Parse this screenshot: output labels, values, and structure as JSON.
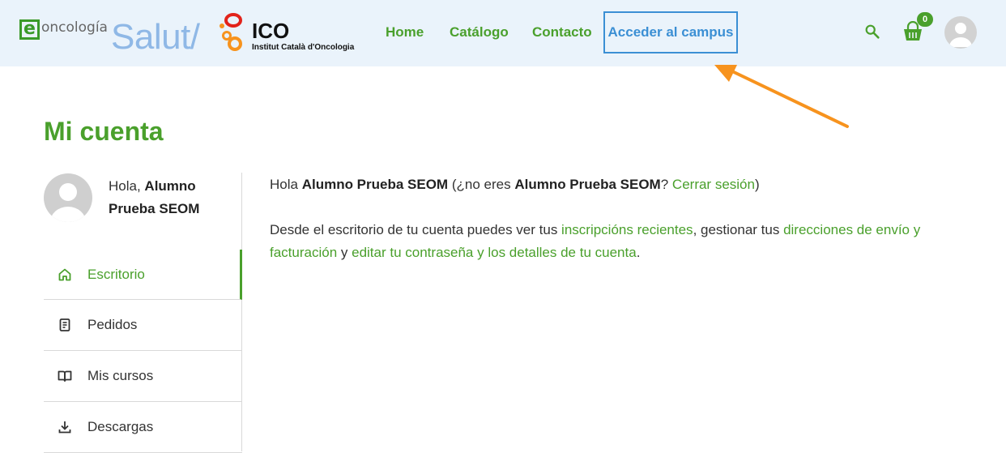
{
  "header": {
    "logo_e_word": "oncología",
    "logo_salut": "Salut/",
    "logo_ico": "ICO",
    "logo_ico_sub": "Institut Català d'Oncologia",
    "nav": [
      {
        "label": "Home"
      },
      {
        "label": "Catálogo"
      },
      {
        "label": "Contacto"
      }
    ],
    "campus_label": "Acceder al campus",
    "cart_count": "0",
    "icons": {
      "search": "search-icon",
      "cart": "shopping-bag-icon",
      "avatar": "user-avatar-icon"
    },
    "colors": {
      "accent_green": "#4aa02c",
      "campus_blue": "#3b8fd4",
      "header_bg": "#eaf3fb",
      "arrow": "#f7931e"
    }
  },
  "page": {
    "title": "Mi cuenta"
  },
  "sidebar": {
    "greeting_prefix": "Hola, ",
    "user_name": "Alumno Prueba SEOM",
    "items": [
      {
        "label": "Escritorio",
        "icon": "home-icon",
        "active": true
      },
      {
        "label": "Pedidos",
        "icon": "receipt-icon",
        "active": false
      },
      {
        "label": "Mis cursos",
        "icon": "book-icon",
        "active": false
      },
      {
        "label": "Descargas",
        "icon": "download-icon",
        "active": false
      }
    ]
  },
  "main": {
    "line1": {
      "hola": "Hola ",
      "name": "Alumno Prueba SEOM",
      "mid": " (¿no eres ",
      "name2": "Alumno Prueba SEOM",
      "q": "? ",
      "logout": "Cerrar sesión",
      "close": ")"
    },
    "line2": {
      "t1": "Desde el escritorio de tu cuenta puedes ver tus ",
      "l1": "inscripcións recientes",
      "t2": ", gestionar tus ",
      "l2": "direcciones de envío y facturación",
      "t3": " y ",
      "l3": "editar tu contraseña y los detalles de tu cuenta",
      "t4": "."
    }
  }
}
